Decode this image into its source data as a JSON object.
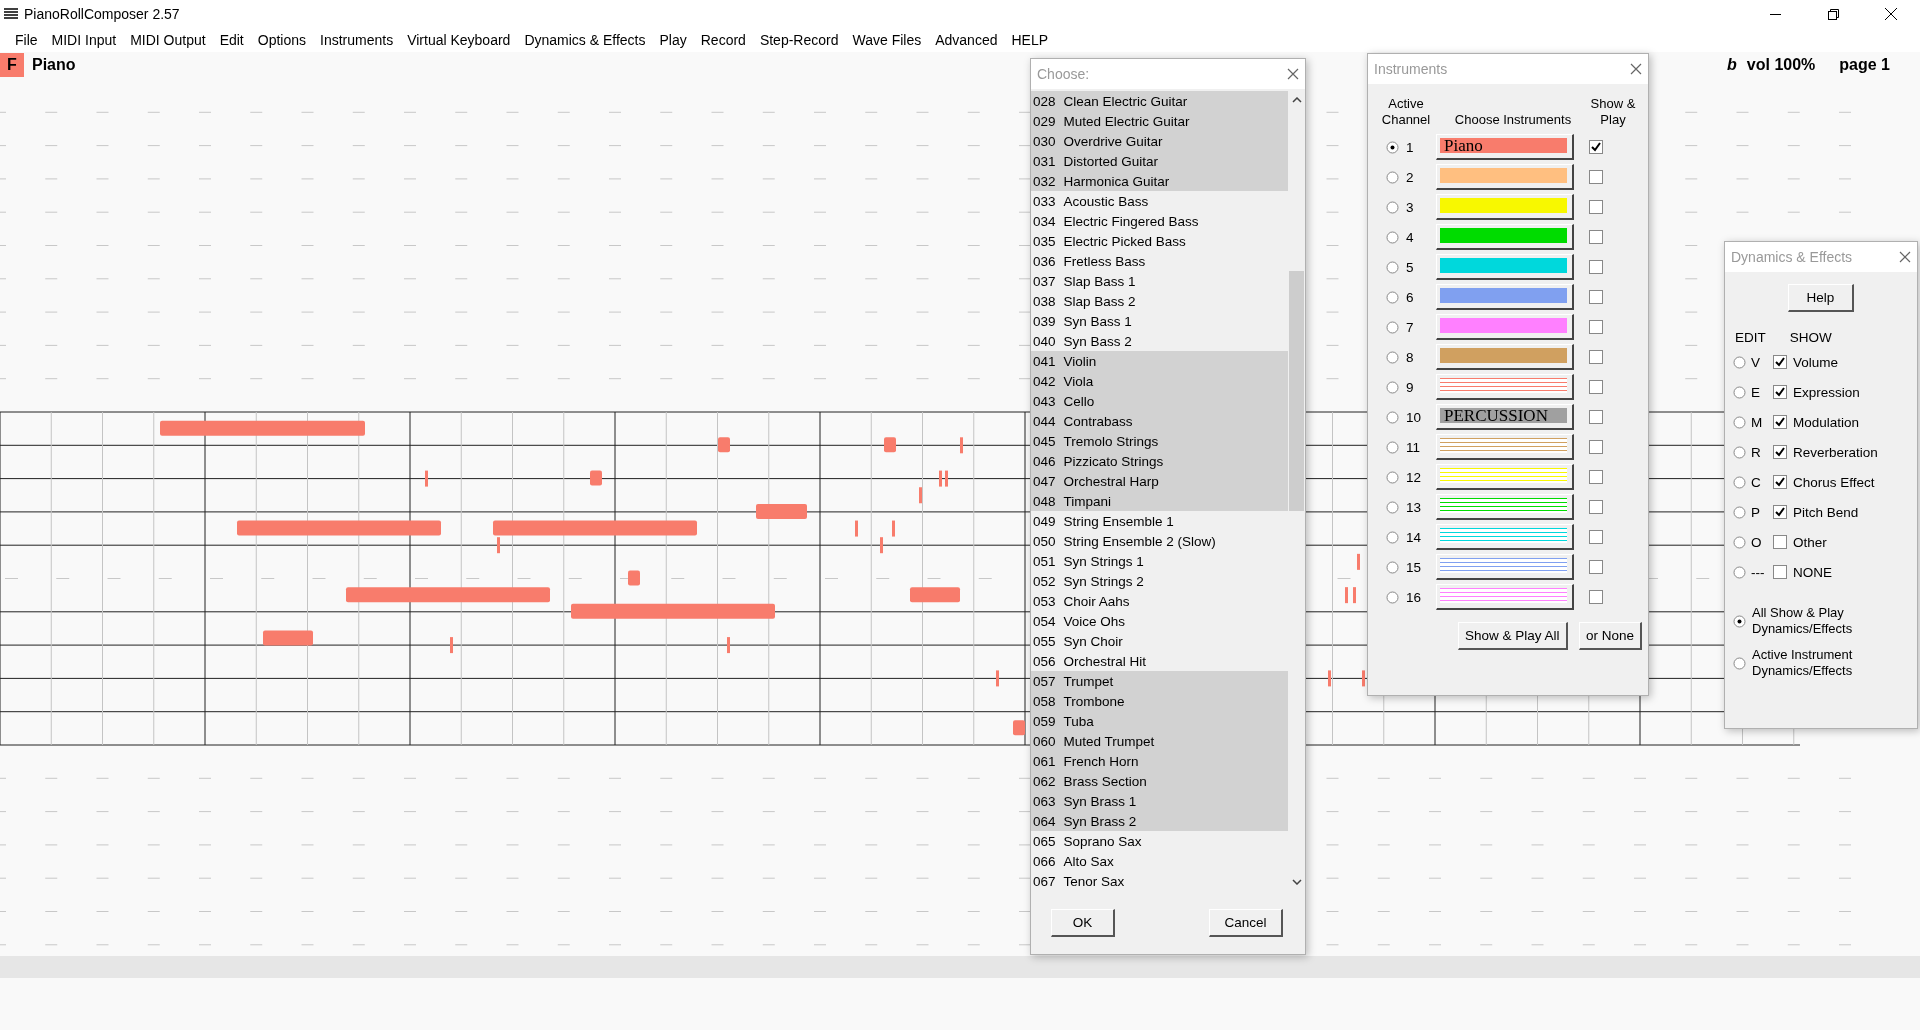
{
  "window": {
    "title": "PianoRollComposer 2.57"
  },
  "menu": [
    "File",
    "MIDI Input",
    "MIDI Output",
    "Edit",
    "Options",
    "Instruments",
    "Virtual Keyboard",
    "Dynamics & Effects",
    "Play",
    "Record",
    "Step-Record",
    "Wave Files",
    "Advanced",
    "HELP"
  ],
  "track": {
    "badge": "F",
    "name": "Piano"
  },
  "status": {
    "flat": "b",
    "volume": "vol 100%",
    "page": "page 1"
  },
  "choose_dialog": {
    "title": "Choose:",
    "items": [
      {
        "number": "028",
        "name": "Clean Electric Guitar",
        "shaded": true
      },
      {
        "number": "029",
        "name": "Muted Electric Guitar",
        "shaded": true
      },
      {
        "number": "030",
        "name": "Overdrive Guitar",
        "shaded": true
      },
      {
        "number": "031",
        "name": "Distorted Guitar",
        "shaded": true
      },
      {
        "number": "032",
        "name": "Harmonica Guitar",
        "shaded": true
      },
      {
        "number": "033",
        "name": "Acoustic Bass",
        "shaded": false
      },
      {
        "number": "034",
        "name": "Electric Fingered Bass",
        "shaded": false
      },
      {
        "number": "035",
        "name": "Electric Picked Bass",
        "shaded": false
      },
      {
        "number": "036",
        "name": "Fretless Bass",
        "shaded": false
      },
      {
        "number": "037",
        "name": "Slap Bass 1",
        "shaded": false
      },
      {
        "number": "038",
        "name": "Slap Bass 2",
        "shaded": false
      },
      {
        "number": "039",
        "name": "Syn Bass 1",
        "shaded": false
      },
      {
        "number": "040",
        "name": "Syn Bass 2",
        "shaded": false
      },
      {
        "number": "041",
        "name": "Violin",
        "shaded": true
      },
      {
        "number": "042",
        "name": "Viola",
        "shaded": true
      },
      {
        "number": "043",
        "name": "Cello",
        "shaded": true
      },
      {
        "number": "044",
        "name": "Contrabass",
        "shaded": true
      },
      {
        "number": "045",
        "name": "Tremolo Strings",
        "shaded": true
      },
      {
        "number": "046",
        "name": "Pizzicato Strings",
        "shaded": true
      },
      {
        "number": "047",
        "name": "Orchestral Harp",
        "shaded": true
      },
      {
        "number": "048",
        "name": "Timpani",
        "shaded": true
      },
      {
        "number": "049",
        "name": "String Ensemble 1",
        "shaded": false
      },
      {
        "number": "050",
        "name": "String Ensemble 2 (Slow)",
        "shaded": false
      },
      {
        "number": "051",
        "name": "Syn Strings 1",
        "shaded": false
      },
      {
        "number": "052",
        "name": "Syn Strings 2",
        "shaded": false
      },
      {
        "number": "053",
        "name": "Choir Aahs",
        "shaded": false
      },
      {
        "number": "054",
        "name": "Voice Ohs",
        "shaded": false
      },
      {
        "number": "055",
        "name": "Syn Choir",
        "shaded": false
      },
      {
        "number": "056",
        "name": "Orchestral Hit",
        "shaded": false
      },
      {
        "number": "057",
        "name": "Trumpet",
        "shaded": true
      },
      {
        "number": "058",
        "name": "Trombone",
        "shaded": true
      },
      {
        "number": "059",
        "name": "Tuba",
        "shaded": true
      },
      {
        "number": "060",
        "name": "Muted Trumpet",
        "shaded": true
      },
      {
        "number": "061",
        "name": "French Horn",
        "shaded": true
      },
      {
        "number": "062",
        "name": "Brass Section",
        "shaded": true
      },
      {
        "number": "063",
        "name": "Syn Brass 1",
        "shaded": true
      },
      {
        "number": "064",
        "name": "Syn Brass 2",
        "shaded": true
      },
      {
        "number": "065",
        "name": "Soprano Sax",
        "shaded": false
      },
      {
        "number": "066",
        "name": "Alto Sax",
        "shaded": false
      },
      {
        "number": "067",
        "name": "Tenor Sax",
        "shaded": false
      }
    ],
    "buttons": [
      "OK",
      "Cancel"
    ]
  },
  "instruments_dialog": {
    "title": "Instruments",
    "headers": [
      "Active Channel",
      "Choose Instruments",
      "Show & Play"
    ],
    "channels": [
      {
        "number": "1",
        "selected": true,
        "color": "#f87c6c",
        "kind": "solid",
        "name": "Piano",
        "show_play": true
      },
      {
        "number": "2",
        "selected": false,
        "color": "#ffbf80",
        "kind": "solid",
        "show_play": false
      },
      {
        "number": "3",
        "selected": false,
        "color": "#f8f800",
        "kind": "solid",
        "show_play": false
      },
      {
        "number": "4",
        "selected": false,
        "color": "#00dc00",
        "kind": "solid",
        "show_play": false
      },
      {
        "number": "5",
        "selected": false,
        "color": "#00d8dc",
        "kind": "solid",
        "show_play": false
      },
      {
        "number": "6",
        "selected": false,
        "color": "#80a0f0",
        "kind": "solid",
        "show_play": false
      },
      {
        "number": "7",
        "selected": false,
        "color": "#ff80ff",
        "kind": "solid",
        "show_play": false
      },
      {
        "number": "8",
        "selected": false,
        "color": "#d0a060",
        "kind": "solid",
        "show_play": false
      },
      {
        "number": "9",
        "selected": false,
        "color": "#f87c6c",
        "kind": "striped",
        "show_play": false
      },
      {
        "number": "10",
        "selected": false,
        "color": "#a0a0a0",
        "kind": "solid",
        "name": "PERCUSSION",
        "show_play": false
      },
      {
        "number": "11",
        "selected": false,
        "color": "#d0a060",
        "kind": "striped",
        "show_play": false
      },
      {
        "number": "12",
        "selected": false,
        "color": "#f8f800",
        "kind": "striped",
        "show_play": false
      },
      {
        "number": "13",
        "selected": false,
        "color": "#00dc00",
        "kind": "striped",
        "show_play": false
      },
      {
        "number": "14",
        "selected": false,
        "color": "#00d8dc",
        "kind": "striped",
        "show_play": false
      },
      {
        "number": "15",
        "selected": false,
        "color": "#80a0f0",
        "kind": "striped",
        "show_play": false
      },
      {
        "number": "16",
        "selected": false,
        "color": "#ff80ff",
        "kind": "striped",
        "show_play": false
      }
    ],
    "buttons": [
      "Show & Play All",
      "or None"
    ]
  },
  "dynamics_dialog": {
    "title": "Dynamics & Effects",
    "help": "Help",
    "headers": [
      "EDIT",
      "SHOW"
    ],
    "effects": [
      {
        "letter": "V",
        "label": "Volume",
        "selected": false,
        "show": true
      },
      {
        "letter": "E",
        "label": "Expression",
        "selected": false,
        "show": true
      },
      {
        "letter": "M",
        "label": "Modulation",
        "selected": false,
        "show": true
      },
      {
        "letter": "R",
        "label": "Reverberation",
        "selected": false,
        "show": true
      },
      {
        "letter": "C",
        "label": "Chorus Effect",
        "selected": false,
        "show": true
      },
      {
        "letter": "P",
        "label": "Pitch Bend",
        "selected": false,
        "show": true
      },
      {
        "letter": "O",
        "label": "Other",
        "selected": false,
        "show": false
      },
      {
        "letter": "---",
        "label": "NONE",
        "selected": false,
        "show": false
      }
    ],
    "scope": [
      {
        "label": "All Show & Play Dynamics/Effects",
        "selected": true
      },
      {
        "label": "Active Instrument Dynamics/Effects",
        "selected": false
      }
    ]
  }
}
